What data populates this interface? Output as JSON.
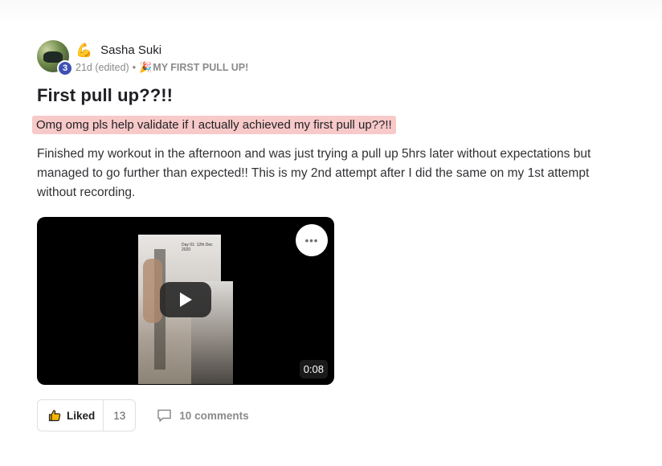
{
  "author": {
    "name": "Sasha Suki",
    "level": "3",
    "flair_emoji": "💪",
    "time": "21d (edited)",
    "separator": "•",
    "category_emoji": "🎉",
    "category": "MY FIRST PULL UP!"
  },
  "post": {
    "title": "First pull up??!!",
    "highlight": "Omg omg pls help validate if I actually achieved my first pull up??!!",
    "body": "Finished my workout in the afternoon and was just trying a pull up 5hrs later without expectations but managed to go further than expected!! This is my 2nd attempt after I did the same on my 1st attempt without recording."
  },
  "video": {
    "duration": "0:08",
    "thumbnail_caption": "Day 01: 12th Dec 2020",
    "more_icon": "•••"
  },
  "actions": {
    "like_label": "Liked",
    "like_count": "13",
    "comments_label": "10 comments"
  }
}
